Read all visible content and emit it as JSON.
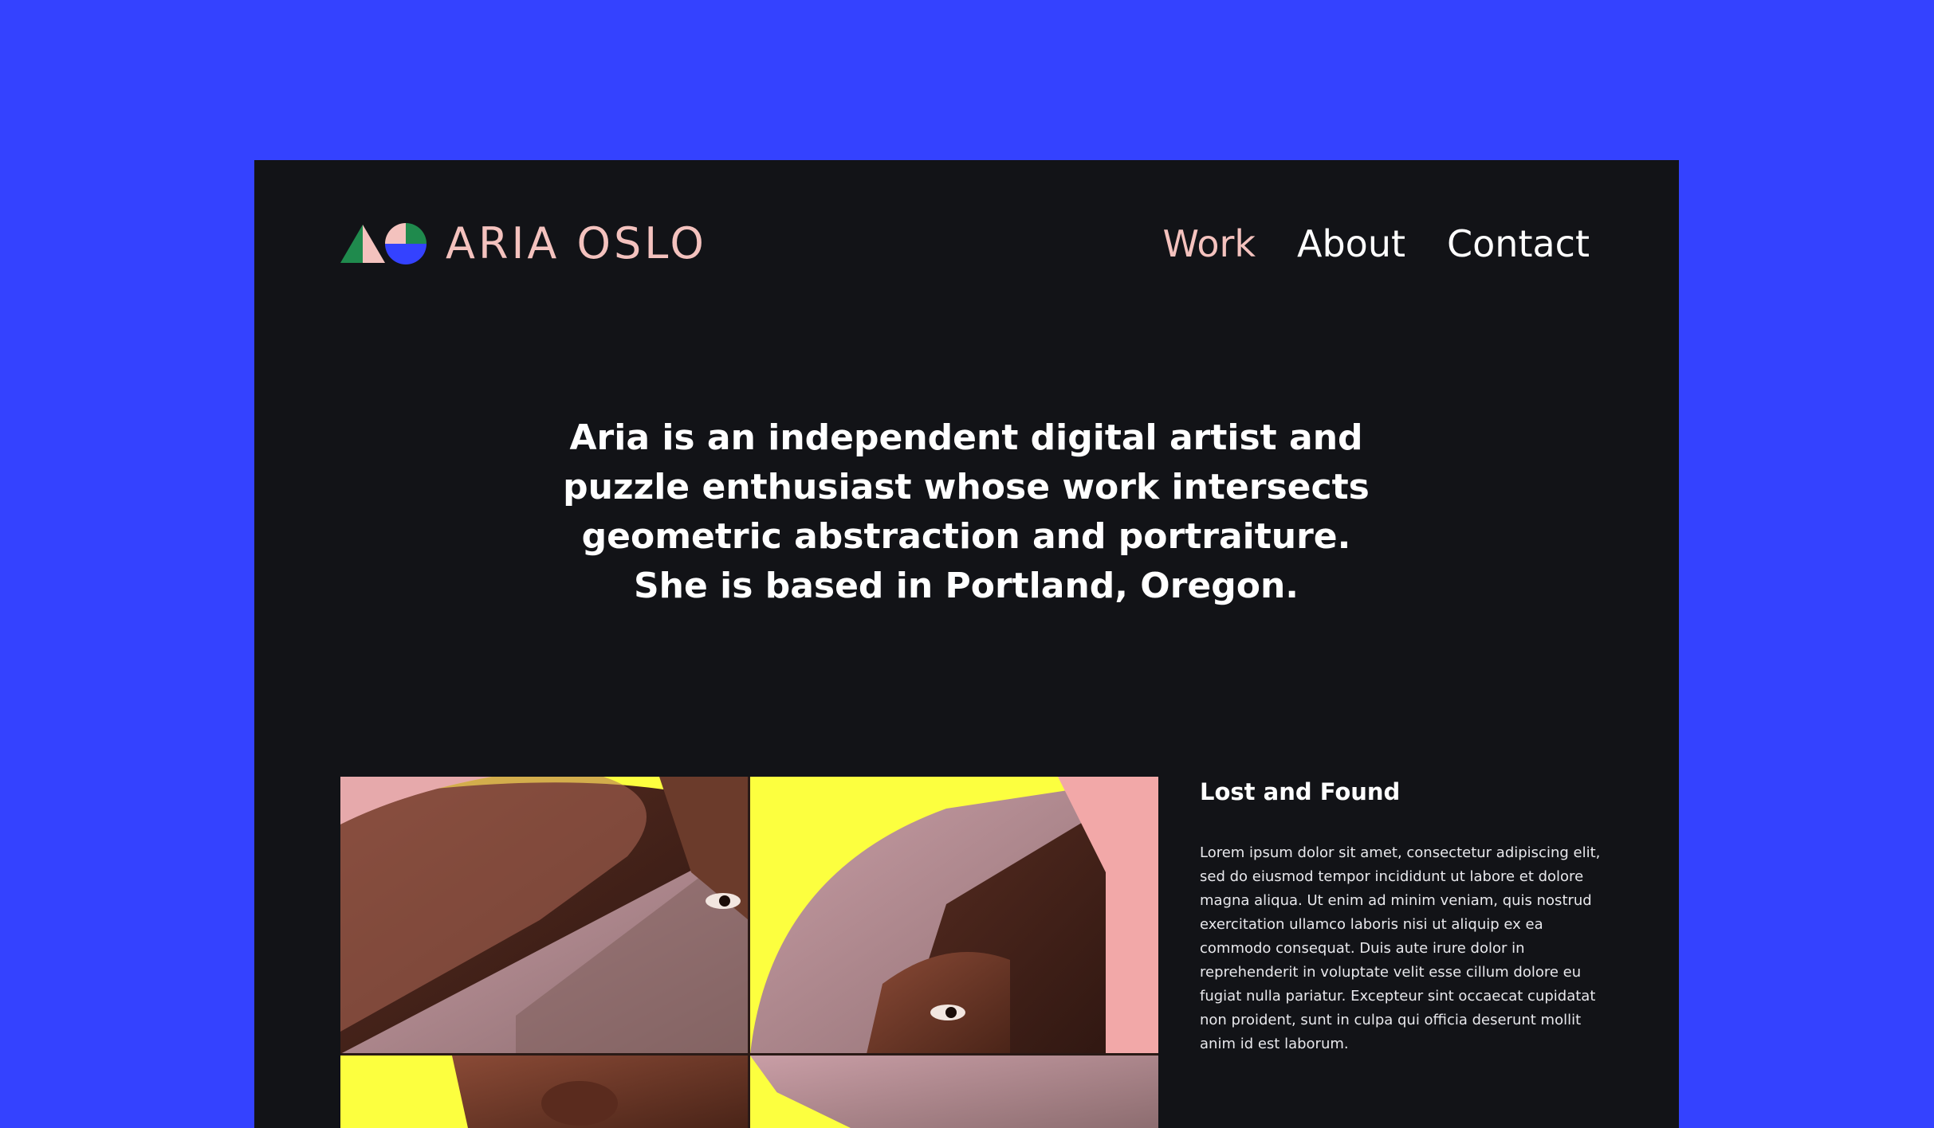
{
  "brand": {
    "name": "ARIA OSLO",
    "colors": {
      "background": "#3442ff",
      "panel": "#121317",
      "accent_pink": "#f4c2be",
      "green": "#1f8a4d",
      "yellow": "#fcff3f",
      "blue": "#3442ff"
    }
  },
  "nav": {
    "items": [
      {
        "label": "Work",
        "active": true
      },
      {
        "label": "About",
        "active": false
      },
      {
        "label": "Contact",
        "active": false
      }
    ]
  },
  "intro": {
    "text": "Aria is an independent digital artist and puzzle enthusiast whose work intersects geometric abstraction and portraiture. She is based in Portland, Oregon."
  },
  "project": {
    "title": "Lost and Found",
    "description": "Lorem ipsum dolor sit amet, consectetur adipiscing elit, sed do eiusmod tempor incididunt ut labore et dolore magna aliqua. Ut enim ad minim veniam, quis nostrud exercitation ullamco laboris nisi ut aliquip ex ea commodo consequat. Duis aute irure dolor in reprehenderit in voluptate velit esse cillum dolore eu fugiat nulla pariatur. Excepteur sint occaecat cupidatat non proident, sunt in culpa qui officia deserunt mollit anim id est laborum."
  },
  "icons": {
    "logo": "geometric-logo-icon"
  }
}
